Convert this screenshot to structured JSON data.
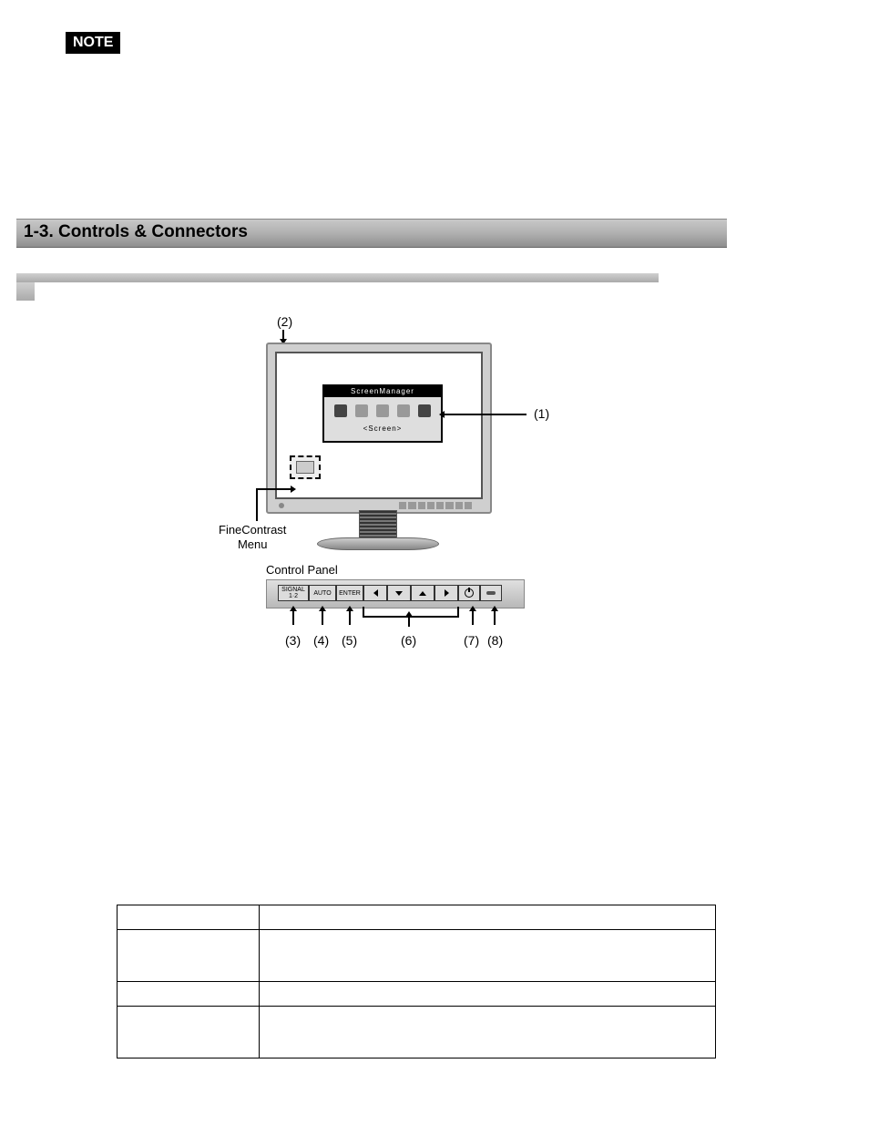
{
  "note_label": "NOTE",
  "heading": "1-3. Controls & Connectors",
  "diagram": {
    "callout_1": "(1)",
    "callout_2": "(2)",
    "osd_title": "ScreenManager",
    "osd_subtitle": "<Screen>",
    "finecontrast_label": "FineContrast\nMenu",
    "control_panel_label": "Control Panel",
    "buttons": {
      "signal_top": "SIGNAL",
      "signal_bottom": "1·2",
      "auto": "AUTO",
      "enter": "ENTER"
    },
    "callouts_bottom": {
      "n3": "(3)",
      "n4": "(4)",
      "n5": "(5)",
      "n6": "(6)",
      "n7": "(7)",
      "n8": "(8)"
    }
  }
}
